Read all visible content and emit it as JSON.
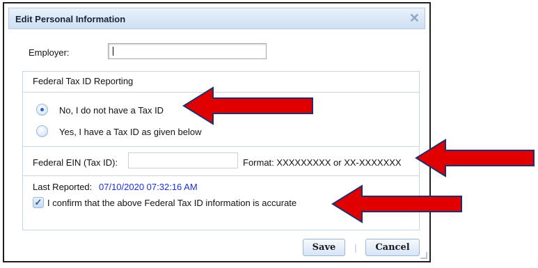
{
  "dialog": {
    "title": "Edit Personal Information",
    "close_icon": "close-icon"
  },
  "employer": {
    "label": "Employer:",
    "value": ""
  },
  "tax_section": {
    "legend": "Federal Tax ID Reporting",
    "options": [
      {
        "label": "No, I do not have a Tax ID",
        "selected": true
      },
      {
        "label": "Yes, I have a Tax ID as given below",
        "selected": false
      }
    ],
    "ein_label": "Federal EIN (Tax ID):",
    "ein_value": "",
    "format_hint": "Format: XXXXXXXXX or XX-XXXXXXX",
    "last_reported_label": "Last Reported:",
    "last_reported_value": "07/10/2020 07:32:16 AM",
    "confirm_label": "I confirm that the above Federal Tax ID information is accurate",
    "confirm_checked": true
  },
  "buttons": {
    "save": "Save",
    "cancel": "Cancel"
  },
  "colors": {
    "arrow": "#e00000",
    "arrow_outline": "#1f2f6b",
    "accent_link": "#1c2fd6"
  }
}
